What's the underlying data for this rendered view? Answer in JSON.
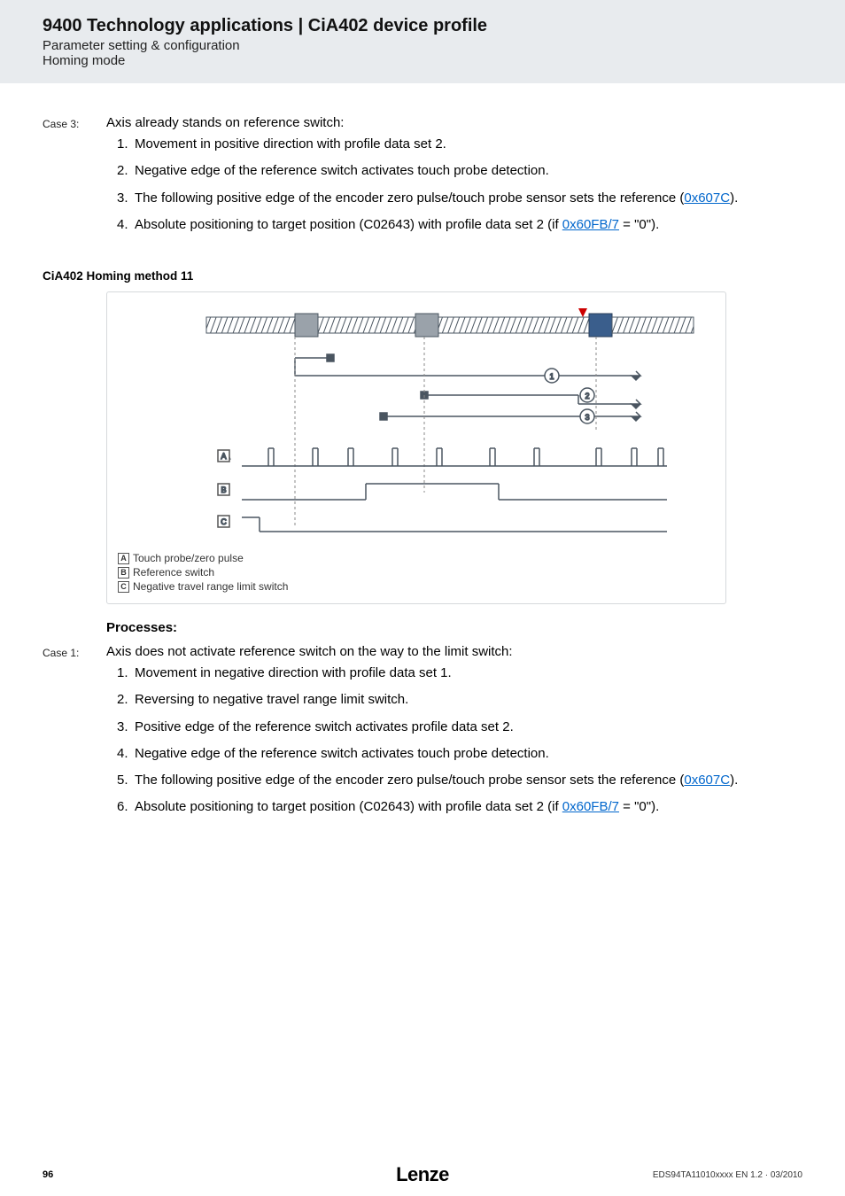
{
  "header": {
    "title": "9400 Technology applications | CiA402 device profile",
    "subtitle1": "Parameter setting & configuration",
    "subtitle2": "Homing mode"
  },
  "case3": {
    "label": "Case 3:",
    "heading": "Axis already stands on reference switch:",
    "items": [
      {
        "text_a": "Movement in positive direction with profile data set 2."
      },
      {
        "text_a": "Negative edge of the reference switch activates touch probe detection."
      },
      {
        "text_a": "The following positive edge of the encoder zero pulse/touch probe sensor sets the reference (",
        "link": "0x607C",
        "text_b": ")."
      },
      {
        "text_a": "Absolute positioning to target position (C02643) with profile data set 2 (if ",
        "link": "0x60FB/7",
        "text_b": " = \"0\")."
      }
    ]
  },
  "method11": {
    "title": "CiA402 Homing method 11",
    "legend": {
      "A": "Touch probe/zero pulse",
      "B": "Reference switch",
      "C": "Negative travel range limit switch"
    }
  },
  "processes_heading": "Processes:",
  "case1": {
    "label": "Case 1:",
    "heading": "Axis does not activate reference switch on the way to the limit switch:",
    "items": [
      {
        "text_a": "Movement in negative direction with profile data set 1."
      },
      {
        "text_a": "Reversing to negative travel range limit switch."
      },
      {
        "text_a": "Positive edge of the reference switch activates profile data set 2."
      },
      {
        "text_a": "Negative edge of the reference switch activates touch probe detection."
      },
      {
        "text_a": "The following positive edge of the encoder zero pulse/touch probe sensor sets the reference (",
        "link": "0x607C",
        "text_b": ")."
      },
      {
        "text_a": "Absolute positioning to target position (C02643) with profile data set 2 (if ",
        "link": "0x60FB/7",
        "text_b": " = \"0\")."
      }
    ]
  },
  "footer": {
    "page": "96",
    "logo": "Lenze",
    "code": "EDS94TA11010xxxx EN 1.2 · 03/2010"
  },
  "chart_data": {
    "type": "diagram",
    "title": "CiA402 Homing method 11",
    "rail": {
      "gaps_at": [
        "block_grey_left",
        "block_grey_mid",
        "block_blue_right"
      ],
      "start_marker": "red_triangle_top_right_area"
    },
    "trajectories": [
      {
        "id": 1,
        "segments": [
          "short_right_from_left_start",
          "hook_down",
          "right_to_far_right"
        ],
        "end": "arrow_right"
      },
      {
        "id": 2,
        "segments": [
          "right_from_mid",
          "down_step",
          "right_to_far_right"
        ],
        "end": "arrow_right"
      },
      {
        "id": 3,
        "segments": [
          "left_from_right_start",
          "short_right_after_reverse"
        ],
        "end": "arrow_right"
      }
    ],
    "signal_traces": [
      {
        "label": "A",
        "name": "Touch probe/zero pulse",
        "type": "pulse_train",
        "pulses": 10
      },
      {
        "label": "B",
        "name": "Reference switch",
        "type": "step",
        "high_region": "center"
      },
      {
        "label": "C",
        "name": "Negative travel range limit switch",
        "type": "step",
        "high_region": "left_edge_only"
      }
    ]
  }
}
